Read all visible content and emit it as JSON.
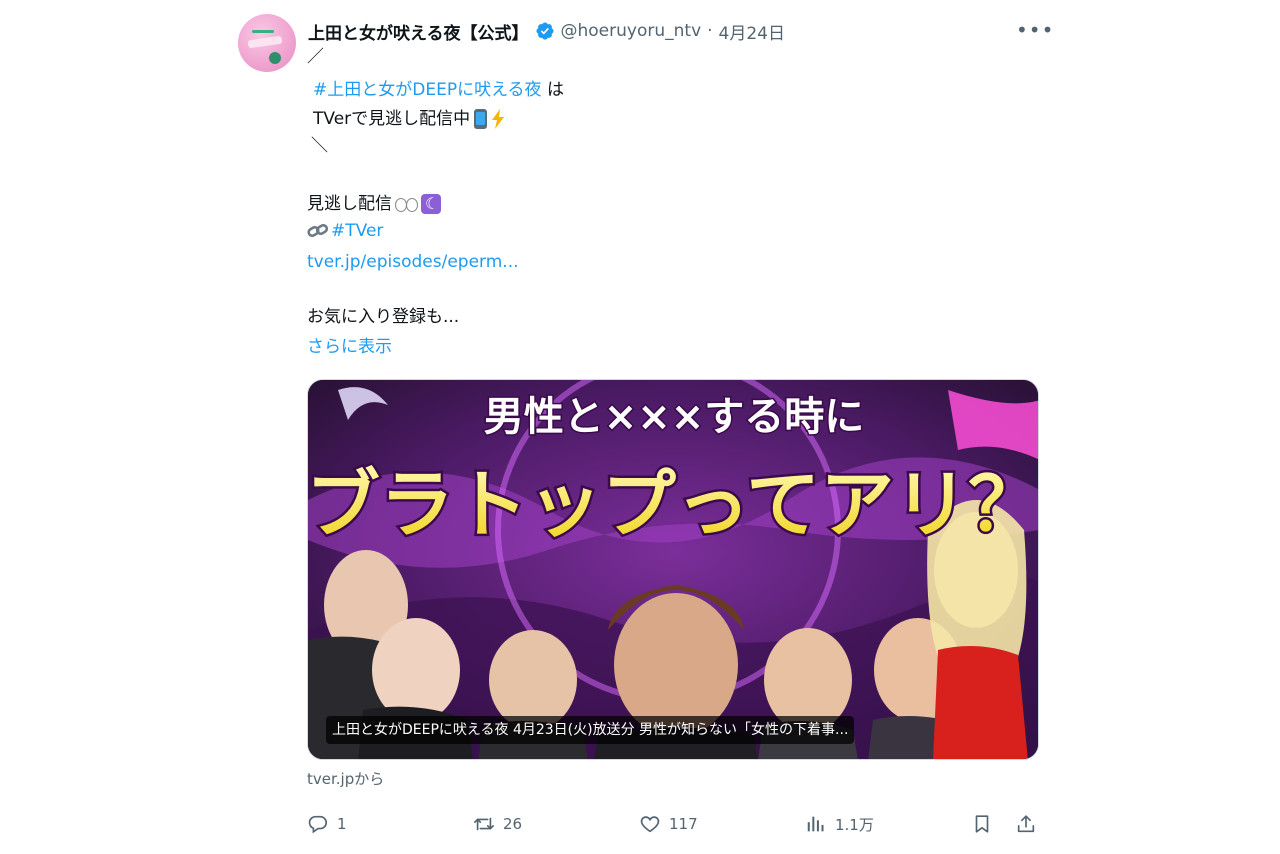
{
  "author": {
    "display_name": "上田と女が吠える夜【公式】",
    "handle": "@hoeruyoru_ntv",
    "separator": "·",
    "date": "4月24日",
    "verified": true
  },
  "tweet": {
    "line_slash_open": "／",
    "hashtag_show": "#上田と女がDEEPに吠える夜",
    "after_hashtag": " は",
    "line_tver": "TVerで見逃し配信中",
    "line_slash_close": "＼",
    "line_missed": "見逃し配信",
    "hashtag_tver": "#TVer",
    "link_url": "tver.jp/episodes/eperm...",
    "line_favorite": "お気に入り登録も...",
    "show_more": "さらに表示"
  },
  "card": {
    "title_top": "男性と×××する時に",
    "title_main": "ブラトップってアリ？",
    "caption": "上田と女がDEEPに吠える夜 4月23日(火)放送分 男性が知らない「女性の下着事...",
    "source": "tver.jpから"
  },
  "actions": {
    "reply_count": "1",
    "retweet_count": "26",
    "like_count": "117",
    "views_count": "1.1万"
  },
  "icons": {
    "more": "more-icon",
    "verified": "verified-badge-icon",
    "reply": "reply-icon",
    "retweet": "retweet-icon",
    "like": "heart-icon",
    "views": "views-icon",
    "bookmark": "bookmark-icon",
    "share": "share-icon"
  },
  "colors": {
    "accent": "#1d9bf0",
    "text": "#0f1419",
    "muted": "#536471"
  }
}
